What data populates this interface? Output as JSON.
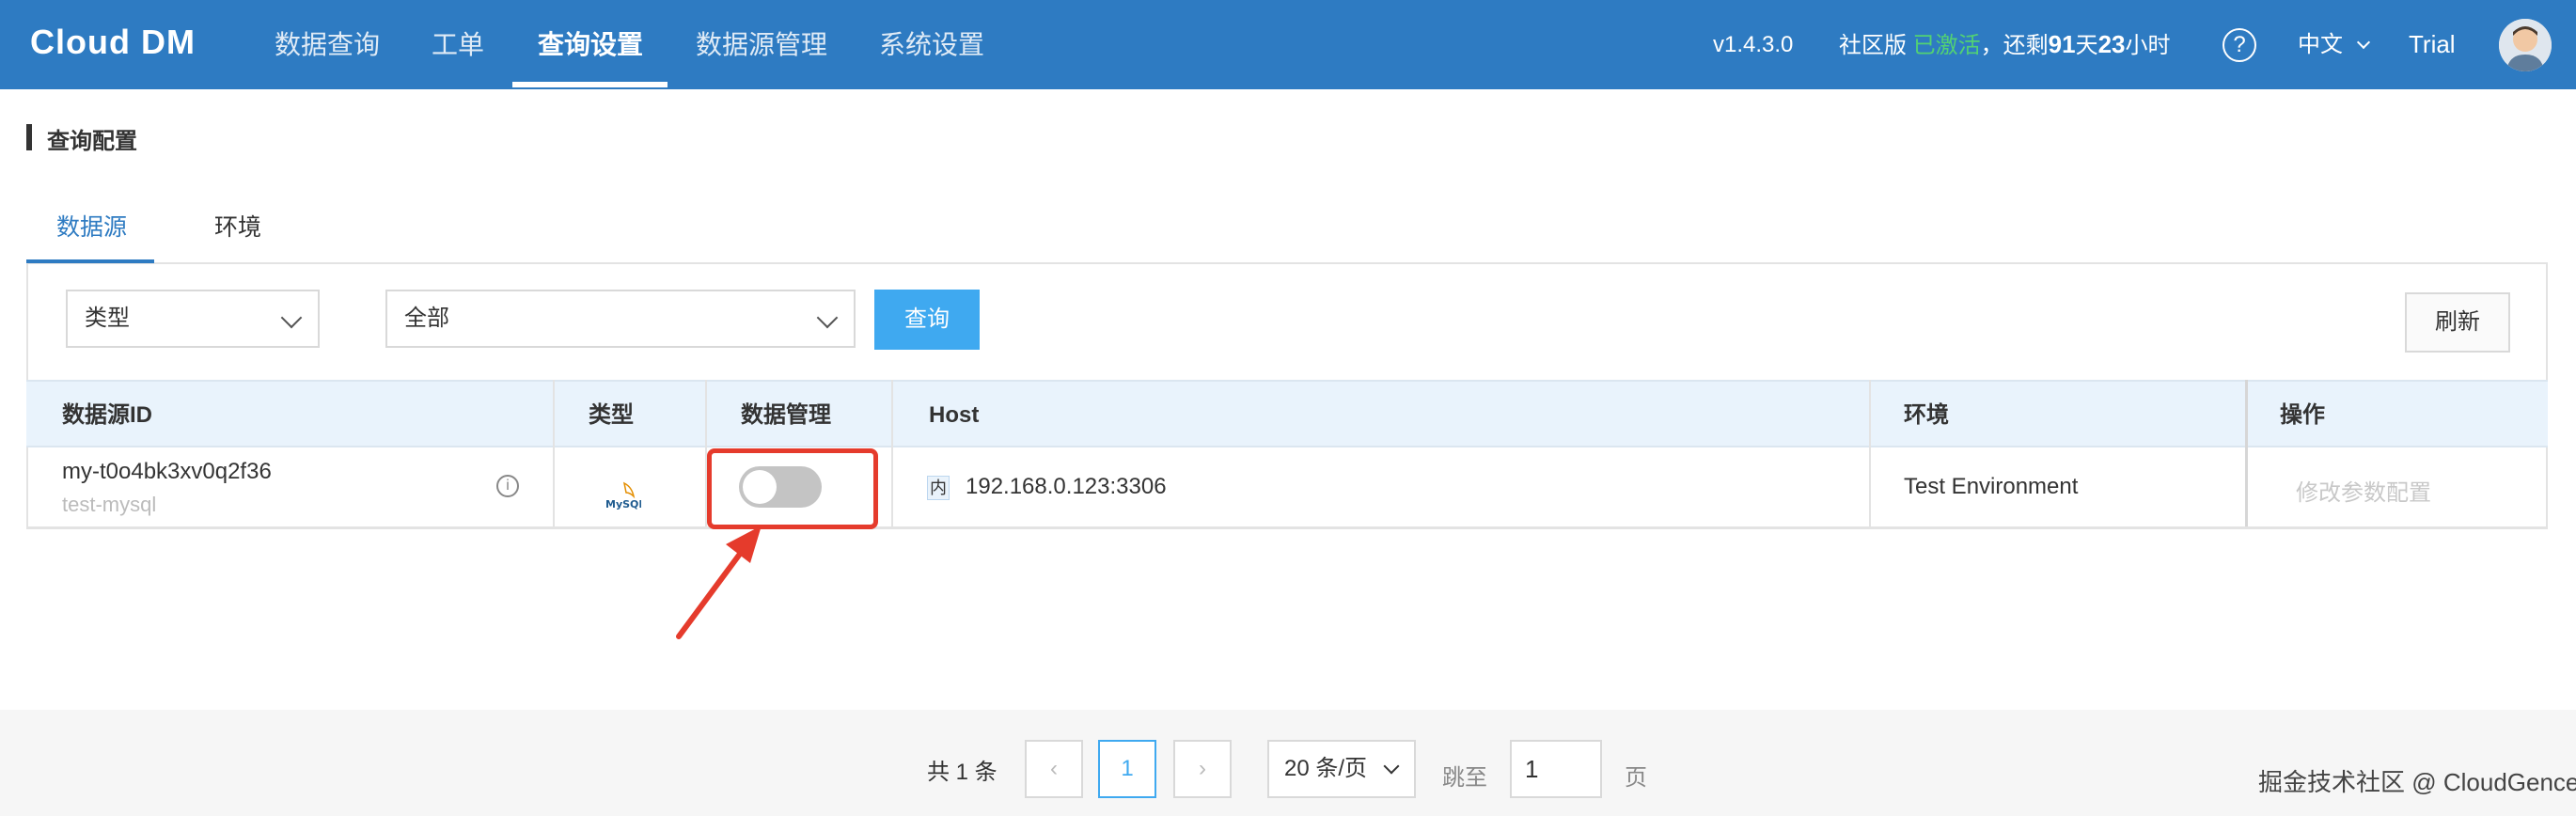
{
  "header": {
    "logo": "Cloud DM",
    "nav": [
      {
        "label": "数据查询"
      },
      {
        "label": "工单"
      },
      {
        "label": "查询设置"
      },
      {
        "label": "数据源管理"
      },
      {
        "label": "系统设置"
      }
    ],
    "version": "v1.4.3.0",
    "edition": "社区版",
    "activated": "已激活",
    "remaining_prefix": "，还剩",
    "days": "91",
    "days_unit": "天",
    "hours": "23",
    "hours_unit": "小时",
    "help": "?",
    "language": "中文",
    "user": "Trial"
  },
  "page": {
    "title": "查询配置",
    "tabs": [
      {
        "label": "数据源"
      },
      {
        "label": "环境"
      }
    ]
  },
  "filters": {
    "type_select": "类型",
    "scope_select": "全部",
    "query_button": "查询",
    "refresh_button": "刷新"
  },
  "table": {
    "columns": [
      "数据源ID",
      "类型",
      "数据管理",
      "Host",
      "环境",
      "操作"
    ],
    "rows": [
      {
        "id": "my-t0o4bk3xv0q2f36",
        "name": "test-mysql",
        "type_logo": "MySQL",
        "data_management": false,
        "net_badge": "内",
        "host": "192.168.0.123:3306",
        "environment": "Test Environment",
        "action": "修改参数配置"
      }
    ]
  },
  "pagination": {
    "total": "共 1 条",
    "prev": "‹",
    "current": "1",
    "next": "›",
    "page_size": "20 条/页",
    "jump_label": "跳至",
    "jump_value": "1",
    "page_unit": "页"
  },
  "watermark": "掘金技术社区 @ CloudGence",
  "colors": {
    "header_bg": "#2e7bc2",
    "accent": "#3fa9f0",
    "activated": "#52d273",
    "highlight": "#e53b2c"
  }
}
